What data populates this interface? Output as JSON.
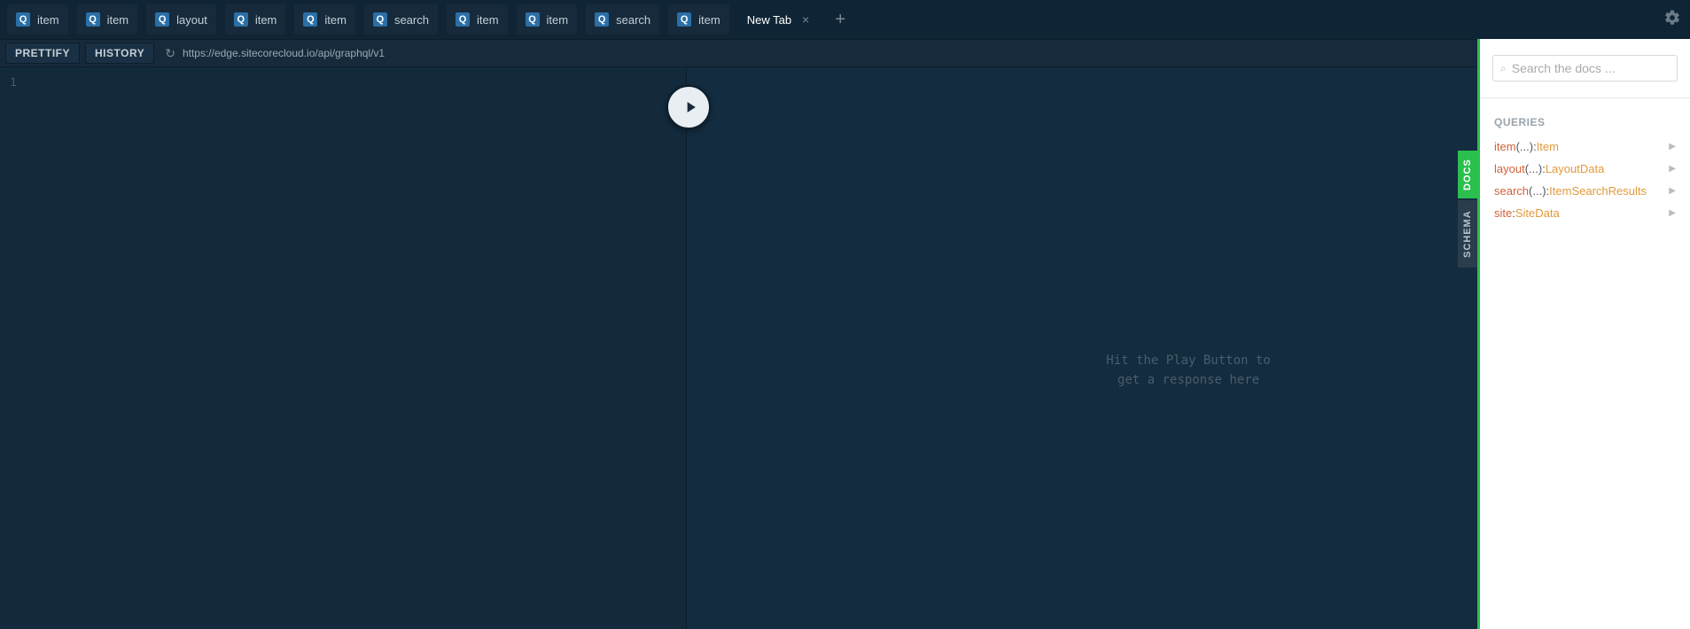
{
  "tabs": [
    {
      "label": "item",
      "badge": "Q"
    },
    {
      "label": "item",
      "badge": "Q"
    },
    {
      "label": "layout",
      "badge": "Q"
    },
    {
      "label": "item",
      "badge": "Q"
    },
    {
      "label": "item",
      "badge": "Q"
    },
    {
      "label": "search",
      "badge": "Q"
    },
    {
      "label": "item",
      "badge": "Q"
    },
    {
      "label": "item",
      "badge": "Q"
    },
    {
      "label": "search",
      "badge": "Q"
    },
    {
      "label": "item",
      "badge": "Q"
    }
  ],
  "active_tab": {
    "label": "New Tab"
  },
  "toolbar": {
    "prettify": "PRETTIFY",
    "history": "HISTORY",
    "url": "https://edge.sitecorecloud.io/api/graphql/v1"
  },
  "editor": {
    "line1": "1"
  },
  "response": {
    "placeholder": "Hit the Play Button to\nget a response here"
  },
  "docs": {
    "search_placeholder": "Search the docs ...",
    "heading": "QUERIES",
    "entries": [
      {
        "name": "item",
        "args": "(...)",
        "sep": ": ",
        "type": "Item"
      },
      {
        "name": "layout",
        "args": "(...)",
        "sep": ": ",
        "type": "LayoutData"
      },
      {
        "name": "search",
        "args": "(...)",
        "sep": ": ",
        "type": "ItemSearchResults"
      },
      {
        "name": "site",
        "args": "",
        "sep": ": ",
        "type": "SiteData"
      }
    ]
  },
  "side_tabs": {
    "docs": "DOCS",
    "schema": "SCHEMA"
  }
}
